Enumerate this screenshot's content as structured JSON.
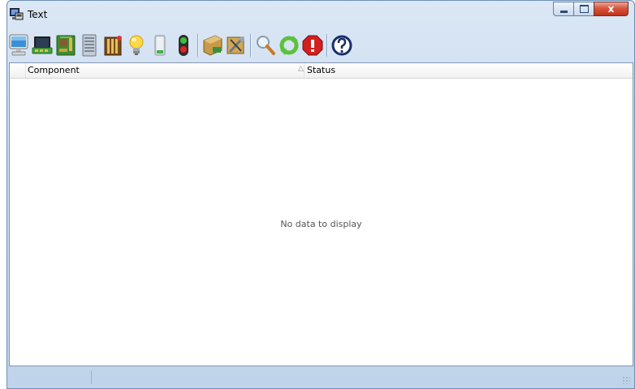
{
  "window": {
    "title": "Text",
    "icons": {
      "app": "computer-window-icon",
      "minimize": "minimize-icon",
      "maximize": "maximize-icon",
      "close": "close-icon",
      "close_glyph": "x"
    }
  },
  "toolbar": {
    "buttons": [
      {
        "icon": "computer-monitor-icon"
      },
      {
        "icon": "network-computer-icon"
      },
      {
        "icon": "circuit-board-icon"
      },
      {
        "icon": "storage-drive-icon"
      },
      {
        "icon": "memory-modules-icon"
      },
      {
        "icon": "light-bulb-icon"
      },
      {
        "icon": "battery-icon"
      },
      {
        "icon": "traffic-light-icon"
      },
      {
        "icon": "hardware-config-icon"
      },
      {
        "icon": "tools-icon"
      },
      {
        "icon": "magnifier-icon"
      },
      {
        "icon": "refresh-icon"
      },
      {
        "icon": "stop-icon"
      },
      {
        "icon": "help-icon"
      }
    ]
  },
  "grid": {
    "columns": [
      {
        "label": "Component"
      },
      {
        "label": "Status"
      }
    ],
    "sort_glyph": "△",
    "empty_message": "No data to display"
  },
  "colors": {
    "window_frame": "#bfd3ea",
    "close_button": "#c0321c",
    "empty_text": "#555555"
  }
}
